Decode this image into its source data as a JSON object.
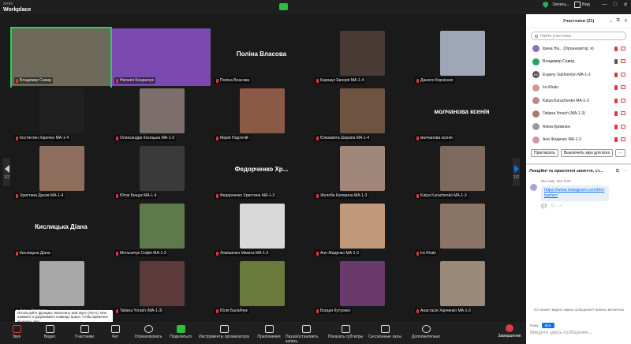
{
  "app": {
    "brand_top": "zoom",
    "brand_bottom": "Workplace"
  },
  "topbar": {
    "recording": "Запись...",
    "video_label": "Вид"
  },
  "gallery": {
    "page_left": "1/2",
    "page_right": "1/2",
    "tiles": [
      {
        "caption": "Владимир Савид",
        "bigname": "",
        "photo": "#6d6a5a",
        "full": true,
        "active": true
      },
      {
        "caption": "Наталія Богданчук",
        "bigname": "",
        "photo": "#7a4ab0",
        "full": true,
        "active": false
      },
      {
        "caption": "Поліна Власова",
        "bigname": "Поліна Власова",
        "photo": "",
        "full": false,
        "active": false
      },
      {
        "caption": "Карнаух Евгерія МА-1-4",
        "bigname": "",
        "photo": "#4a3a34",
        "full": false,
        "active": false
      },
      {
        "caption": "Данило Корнієнко",
        "bigname": "",
        "photo": "#9da7b5",
        "full": false,
        "active": false
      },
      {
        "caption": "Костянтин Харечко МА-1-4",
        "bigname": "",
        "photo": "#202020",
        "full": false,
        "active": false
      },
      {
        "caption": "Олександра Косецька МА-1-3",
        "bigname": "",
        "photo": "#7b6e6b",
        "full": false,
        "active": false
      },
      {
        "caption": "Марія Надточій",
        "bigname": "",
        "photo": "#8a5a46",
        "full": false,
        "active": false
      },
      {
        "caption": "Єлизавета Шарапа МА-1-4",
        "bigname": "",
        "photo": "#6e5440",
        "full": false,
        "active": false
      },
      {
        "caption": "молчанова ксенія",
        "bigname": "молчанова ксенія",
        "photo": "",
        "full": false,
        "active": false
      },
      {
        "caption": "Христина Дасев МА-1-4",
        "bigname": "",
        "photo": "#8d6e5c",
        "full": false,
        "active": false
      },
      {
        "caption": "Югор Бещук МА-1-4",
        "bigname": "",
        "photo": "#3a3a3a",
        "full": false,
        "active": false
      },
      {
        "caption": "Федорченко Христина МА-1-3",
        "bigname": "Федорченко Хр...",
        "photo": "",
        "full": false,
        "active": false
      },
      {
        "caption": "Жолоба Катерина МА-1-3",
        "bigname": "",
        "photo": "#a1877a",
        "full": false,
        "active": false
      },
      {
        "caption": "Katya Kurachenko МА-1-3",
        "bigname": "",
        "photo": "#7d6a5d",
        "full": false,
        "active": false
      },
      {
        "caption": "Кислицька Діана",
        "bigname": "Кислицька Діана",
        "photo": "",
        "full": false,
        "active": false
      },
      {
        "caption": "Мельничук Софія МА-1-3",
        "bigname": "",
        "photo": "#5d7a4a",
        "full": false,
        "active": false
      },
      {
        "caption": "Лемішенко Микита МА-1-3",
        "bigname": "",
        "photo": "#d9d9d9",
        "full": false,
        "active": false
      },
      {
        "caption": "Аня Жиденко МА-1-3",
        "bigname": "",
        "photo": "#c19a7b",
        "full": false,
        "active": false
      },
      {
        "caption": "Ira Khalo",
        "bigname": "",
        "photo": "#8a7466",
        "full": false,
        "active": false
      },
      {
        "caption": "Аліна Крижнюк",
        "bigname": "",
        "photo": "#a8a8a8",
        "full": false,
        "active": false
      },
      {
        "caption": "Tatiana Yorash (МА-1-3)",
        "bigname": "",
        "photo": "#5a3a3a",
        "full": false,
        "active": false
      },
      {
        "caption": "Юлія Балабчук",
        "bigname": "",
        "photo": "#6a7a3a",
        "full": false,
        "active": false
      },
      {
        "caption": "Богдан Кутуонко",
        "bigname": "",
        "photo": "#6a3a6a",
        "full": false,
        "active": false
      },
      {
        "caption": "Анастасія Харченко МА-1-3",
        "bigname": "",
        "photo": "#9a8a7a",
        "full": false,
        "active": false
      }
    ]
  },
  "tooltip": "Используйте функцию «Включить мой звук» (Alt+A). Или нажмите и удерживайте клавишу Space, чтобы временно включить звук.",
  "toolbar": {
    "items": [
      {
        "label": "Звук",
        "icon": "microphone-icon",
        "style": "red"
      },
      {
        "label": "Видео",
        "icon": "camera-icon",
        "style": ""
      },
      {
        "label": "Участники",
        "icon": "participants-icon",
        "style": ""
      },
      {
        "label": "Чат",
        "icon": "chat-icon",
        "style": ""
      },
      {
        "label": "Отреагировать",
        "icon": "heart-icon",
        "style": ""
      },
      {
        "label": "Поделиться",
        "icon": "share-icon",
        "style": "green"
      },
      {
        "label": "Инструменты организатора",
        "icon": "shield-icon",
        "style": ""
      },
      {
        "label": "Приложения",
        "icon": "apps-icon",
        "style": ""
      },
      {
        "label": "Пауза/остановить запись",
        "icon": "record-icon",
        "style": ""
      },
      {
        "label": "Показать субтитры",
        "icon": "captions-icon",
        "style": ""
      },
      {
        "label": "Сессионные залы",
        "icon": "rooms-icon",
        "style": ""
      },
      {
        "label": "Дополнительно",
        "icon": "more-icon",
        "style": ""
      }
    ],
    "end_label": "Завершение"
  },
  "panel": {
    "title": "Участники (31)",
    "search_placeholder": "Найти участника",
    "participants": [
      {
        "name": "Ірина Нік... (Организатор, я)",
        "color": "#8a6fc2",
        "initials": "",
        "mic": "red"
      },
      {
        "name": "Владимир Савид",
        "color": "#27a35f",
        "initials": "",
        "mic": "grey"
      },
      {
        "name": "Evgeny Sukhomlyn МА-1-3",
        "color": "#555555",
        "initials": "ES",
        "mic": "red"
      },
      {
        "name": "Ira Khalo",
        "color": "#c99",
        "initials": "",
        "mic": "red"
      },
      {
        "name": "Katya Kurachenko МА-1-3",
        "color": "#b88",
        "initials": "",
        "mic": "red"
      },
      {
        "name": "Tatiana Yorach (МА-1-3)",
        "color": "#a77",
        "initials": "",
        "mic": "red"
      },
      {
        "name": "Аліна Крижнюк",
        "color": "#999999",
        "initials": "",
        "mic": "red"
      },
      {
        "name": "Аня Жиденко МА-1-3",
        "color": "#c9a",
        "initials": "",
        "mic": "red"
      }
    ],
    "invite": "Пригласить",
    "mute_all": "Выключить звук для всех",
    "chat_title": "Лекційні та практичні заняття, ст...",
    "msg_from": "Вы кому: Всe 8:25",
    "msg_link": "https://www.instagram.com/kforbarber/",
    "chat_info": "Кто может видеть ваши сообщения? Запись включена",
    "to_label": "Кому:",
    "to_value": "Все",
    "compose_placeholder": "Введите здесь сообщение..."
  }
}
